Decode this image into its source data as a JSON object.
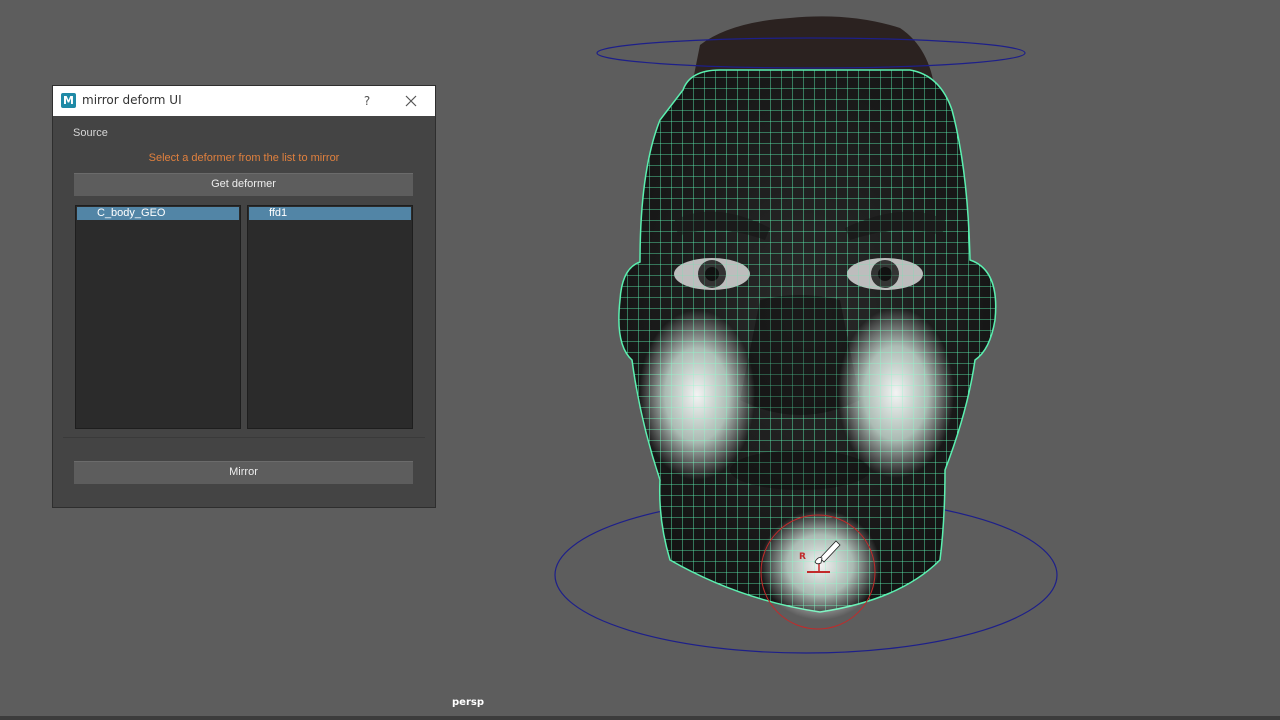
{
  "dialog": {
    "title": "mirror deform UI",
    "app_icon": "maya-logo-icon",
    "app_icon_letter": "M",
    "help_label": "?",
    "close_icon": "close-icon",
    "source_label": "Source",
    "hint": "Select a deformer from the list to mirror",
    "get_deformer_label": "Get deformer",
    "mesh_list": [
      "C_body_GEO"
    ],
    "deformer_list": [
      "ffd1"
    ],
    "mirror_label": "Mirror"
  },
  "viewport": {
    "camera": "persp",
    "brush_label": "R"
  },
  "colors": {
    "viewport_bg": "#5d5d5d",
    "wireframe": "#5bf0b0",
    "hint_text": "#e0803e",
    "selection": "#5285a6",
    "control_curve": "#1d1f8a",
    "brush_circle": "#c22a2a"
  }
}
